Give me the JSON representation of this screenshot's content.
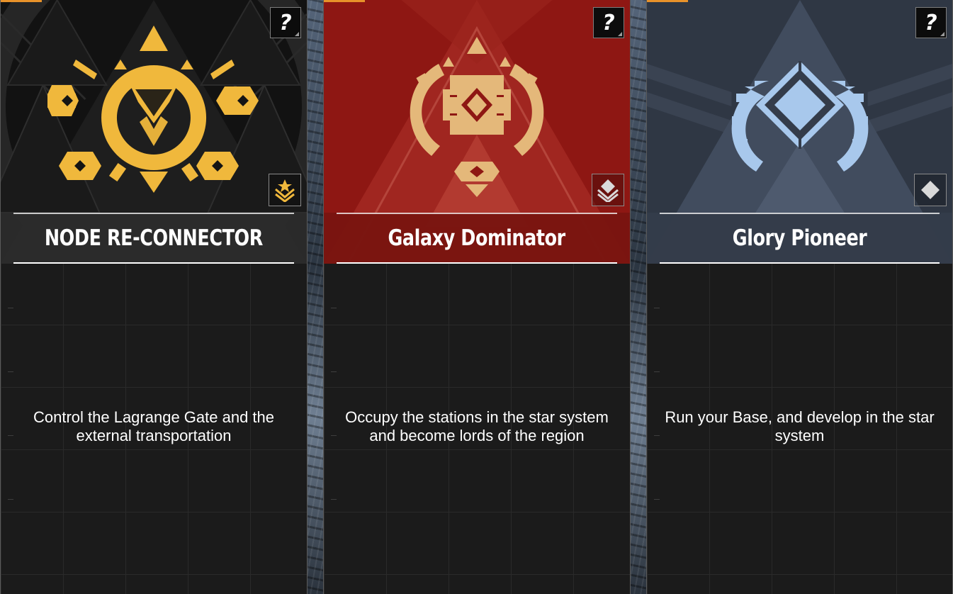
{
  "cards": [
    {
      "title": "NODE RE-CONNECTOR",
      "description": "Control the Lagrange Gate and the external transportation",
      "help_label": "?",
      "rank_icon": "gold-chevron-star-icon",
      "emblem_icon": "triangle-gear-emblem-icon",
      "colors": {
        "banner": "#141414",
        "emblem": "#f0b83c",
        "accent": "#e8922a"
      }
    },
    {
      "title": "Galaxy Dominator",
      "description": "Occupy the stations in the star system and become lords of the region",
      "help_label": "?",
      "rank_icon": "silver-chevron-diamond-icon",
      "emblem_icon": "shield-gear-emblem-icon",
      "colors": {
        "banner": "#8f1a16",
        "emblem": "#e4b87a",
        "accent": "#e8922a"
      }
    },
    {
      "title": "Glory Pioneer",
      "description": "Run your Base, and develop in the star system",
      "help_label": "?",
      "rank_icon": "silver-diamond-icon",
      "emblem_icon": "diamond-gear-emblem-icon",
      "colors": {
        "banner": "#343c4a",
        "emblem": "#a8c8ec",
        "accent": "#e8922a"
      }
    }
  ]
}
